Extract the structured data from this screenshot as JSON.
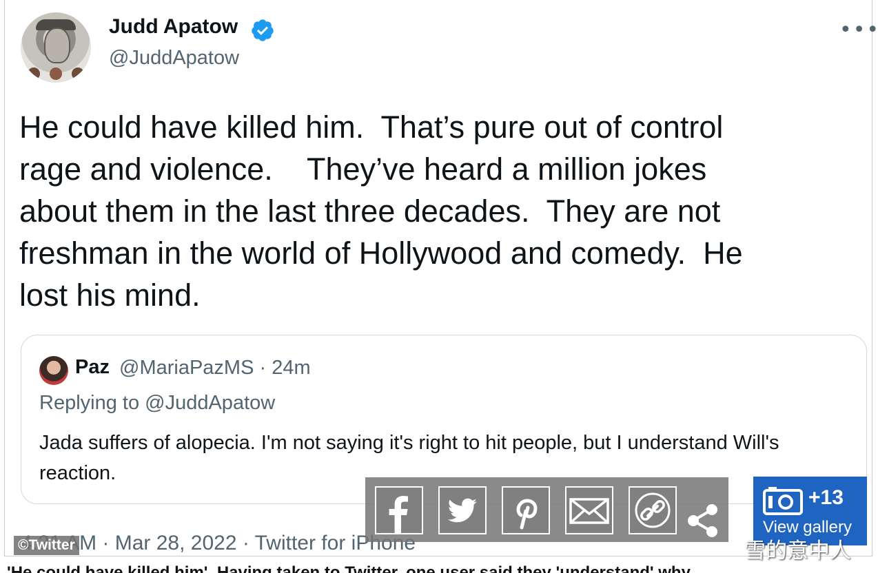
{
  "author": {
    "name": "Judd Apatow",
    "handle": "@JuddApatow",
    "avatar_icon": "profile-photo",
    "verified_color": "#1d9bf0"
  },
  "menu_icon": "more-options-icon",
  "tweet": {
    "text": "He could have killed him.  That’s pure out of control\nrage and violence.    They’ve heard a million jokes\nabout them in the last three decades.  They are not\nfreshman in the world of Hollywood and comedy.  He\nlost his mind."
  },
  "quote": {
    "name": "Paz",
    "meta": "@MariaPazMS · 24m",
    "replying": "Replying to @JuddApatow",
    "text": "Jada suffers of alopecia. I'm not saying it's right to hit people,  but I understand Will's reaction."
  },
  "footer": {
    "timestamp_text": "4:21 AM · Mar 28, 2022 · Twitter for iPhone",
    "source_badge": "©Twitter"
  },
  "share_buttons": [
    {
      "name": "facebook",
      "icon": "facebook-icon"
    },
    {
      "name": "twitter",
      "icon": "twitter-icon"
    },
    {
      "name": "pinterest",
      "icon": "pinterest-icon"
    },
    {
      "name": "email",
      "icon": "mail-icon"
    },
    {
      "name": "link",
      "icon": "link-icon"
    },
    {
      "name": "share",
      "icon": "share-icon"
    }
  ],
  "gallery": {
    "count": "+13",
    "label": "View gallery",
    "icon": "camera-icon",
    "color": "#1f64c0"
  },
  "watermark": "雪的意中人",
  "caption_fragment": "'He could have killed him'. Having taken to Twitter, one user said they 'understand' why"
}
